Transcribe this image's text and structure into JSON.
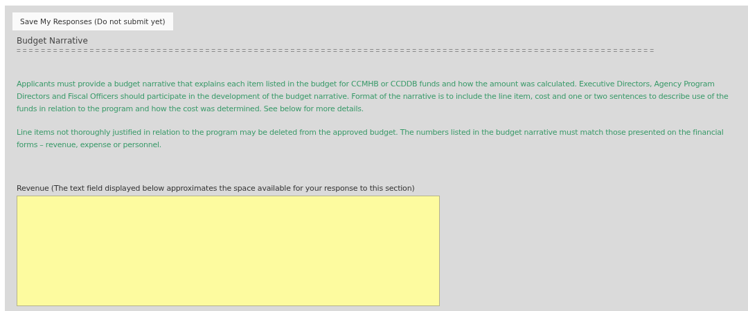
{
  "save_button": {
    "label": "Save My Responses (Do not submit yet)"
  },
  "section_title": "Budget Narrative",
  "separator": "=========================================================================================================",
  "instructions": [
    "Applicants must provide a budget narrative that explains each item listed in the budget for CCMHB or CCDDB funds and how the amount was calculated. Executive Directors, Agency Program Directors and Fiscal Officers should participate in the development of the budget narrative. Format of the narrative is to include the line item, cost and one or two sentences to describe use of the funds in relation to the program and how the cost was determined. See below for more details.",
    "Line items not thoroughly justified in relation to the program may be deleted from the approved budget. The numbers listed in the budget narrative must match those presented on the financial forms – revenue, expense or personnel."
  ],
  "revenue": {
    "label": "Revenue (The text field displayed below approximates the space available for your response to this section)"
  }
}
